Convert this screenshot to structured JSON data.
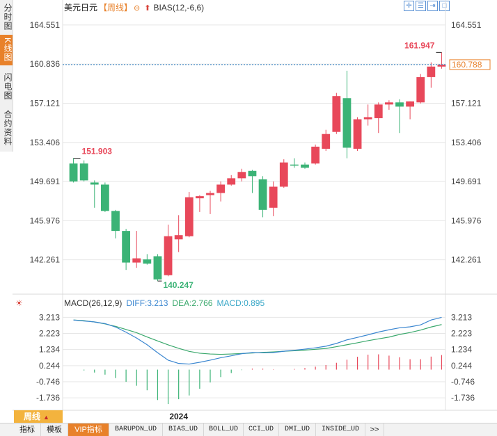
{
  "side_tabs": [
    "分时图",
    "K线图",
    "闪电图",
    "合约资料"
  ],
  "header": {
    "symbol": "美元日元",
    "period": "【周线】",
    "indicator": "BIAS(12,-6,6)"
  },
  "chart_data": {
    "type": "candlestick",
    "y_ticks": [
      "164.551",
      "160.836",
      "157.121",
      "153.406",
      "149.691",
      "145.976",
      "142.261"
    ],
    "ylim": [
      139.2,
      165.6
    ],
    "current_price": "160.788",
    "x_tick_label": "2024",
    "annotations": [
      {
        "text": "151.903",
        "kind": "high"
      },
      {
        "text": "140.247",
        "kind": "low"
      },
      {
        "text": "161.947",
        "kind": "high"
      }
    ],
    "candles": [
      {
        "o": 151.4,
        "h": 151.903,
        "l": 149.6,
        "c": 149.7
      },
      {
        "o": 151.4,
        "h": 151.7,
        "l": 149.7,
        "c": 149.8
      },
      {
        "o": 149.6,
        "h": 149.8,
        "l": 147.2,
        "c": 149.4
      },
      {
        "o": 149.4,
        "h": 149.6,
        "l": 146.8,
        "c": 146.9
      },
      {
        "o": 146.9,
        "h": 147.0,
        "l": 144.3,
        "c": 145.0
      },
      {
        "o": 145.0,
        "h": 145.2,
        "l": 141.3,
        "c": 142.0
      },
      {
        "o": 142.0,
        "h": 145.0,
        "l": 141.5,
        "c": 142.4
      },
      {
        "o": 142.3,
        "h": 142.8,
        "l": 141.8,
        "c": 141.9
      },
      {
        "o": 142.6,
        "h": 142.8,
        "l": 140.247,
        "c": 140.4
      },
      {
        "o": 140.8,
        "h": 145.6,
        "l": 140.7,
        "c": 144.5
      },
      {
        "o": 144.2,
        "h": 146.5,
        "l": 143.0,
        "c": 144.6
      },
      {
        "o": 144.5,
        "h": 148.7,
        "l": 144.4,
        "c": 148.2
      },
      {
        "o": 148.1,
        "h": 148.4,
        "l": 146.8,
        "c": 148.3
      },
      {
        "o": 148.4,
        "h": 148.8,
        "l": 146.6,
        "c": 148.6
      },
      {
        "o": 148.6,
        "h": 149.7,
        "l": 147.8,
        "c": 149.4
      },
      {
        "o": 149.4,
        "h": 150.3,
        "l": 149.3,
        "c": 150.0
      },
      {
        "o": 150.0,
        "h": 150.9,
        "l": 149.7,
        "c": 150.6
      },
      {
        "o": 150.7,
        "h": 150.8,
        "l": 148.6,
        "c": 150.2
      },
      {
        "o": 149.9,
        "h": 150.2,
        "l": 146.3,
        "c": 147.0
      },
      {
        "o": 147.2,
        "h": 149.7,
        "l": 146.4,
        "c": 149.2
      },
      {
        "o": 149.2,
        "h": 151.8,
        "l": 149.1,
        "c": 151.5
      },
      {
        "o": 151.3,
        "h": 151.9,
        "l": 151.0,
        "c": 151.2
      },
      {
        "o": 151.3,
        "h": 151.5,
        "l": 150.9,
        "c": 151.0
      },
      {
        "o": 151.4,
        "h": 153.2,
        "l": 151.3,
        "c": 153.0
      },
      {
        "o": 152.8,
        "h": 154.6,
        "l": 152.6,
        "c": 154.2
      },
      {
        "o": 154.4,
        "h": 158.1,
        "l": 154.2,
        "c": 157.8
      },
      {
        "o": 157.6,
        "h": 160.2,
        "l": 151.9,
        "c": 152.9
      },
      {
        "o": 152.8,
        "h": 155.8,
        "l": 152.6,
        "c": 155.6
      },
      {
        "o": 155.6,
        "h": 157.0,
        "l": 155.0,
        "c": 155.8
      },
      {
        "o": 155.7,
        "h": 157.2,
        "l": 154.3,
        "c": 157.0
      },
      {
        "o": 157.0,
        "h": 157.4,
        "l": 156.5,
        "c": 157.2
      },
      {
        "o": 157.2,
        "h": 157.5,
        "l": 154.3,
        "c": 156.8
      },
      {
        "o": 156.8,
        "h": 157.3,
        "l": 155.6,
        "c": 157.3
      },
      {
        "o": 157.2,
        "h": 159.9,
        "l": 157.1,
        "c": 159.6
      },
      {
        "o": 159.6,
        "h": 161.0,
        "l": 158.6,
        "c": 160.6
      },
      {
        "o": 160.6,
        "h": 161.947,
        "l": 160.4,
        "c": 160.788
      }
    ]
  },
  "macd": {
    "title": "MACD(26,12,9)",
    "diff": "DIFF:3.213",
    "dea": "DEA:2.766",
    "macd": "MACD:0.895",
    "y_ticks": [
      "3.213",
      "2.223",
      "1.234",
      "0.244",
      "-0.746",
      "-1.736"
    ],
    "ylim": [
      -2.5,
      3.7
    ],
    "diff_values": [
      3.05,
      2.99,
      2.93,
      2.83,
      2.62,
      2.3,
      1.94,
      1.53,
      1.04,
      0.58,
      0.38,
      0.34,
      0.45,
      0.58,
      0.73,
      0.85,
      0.98,
      1.05,
      1.03,
      1.05,
      1.13,
      1.19,
      1.26,
      1.34,
      1.44,
      1.61,
      1.83,
      1.98,
      2.14,
      2.31,
      2.45,
      2.57,
      2.63,
      2.75,
      3.05,
      3.21
    ],
    "dea_values": [
      3.05,
      3.01,
      2.93,
      2.81,
      2.66,
      2.47,
      2.27,
      2.01,
      1.76,
      1.52,
      1.31,
      1.12,
      1.01,
      0.96,
      0.94,
      0.96,
      0.99,
      1.02,
      1.06,
      1.09,
      1.13,
      1.16,
      1.2,
      1.25,
      1.3,
      1.41,
      1.53,
      1.65,
      1.78,
      1.89,
      2.0,
      2.16,
      2.28,
      2.43,
      2.62,
      2.77
    ],
    "hist_values": [
      0.0,
      -0.05,
      -0.18,
      -0.31,
      -0.52,
      -0.75,
      -0.99,
      -1.27,
      -1.87,
      -2.12,
      -1.82,
      -1.59,
      -1.18,
      -0.79,
      -0.46,
      -0.21,
      -0.03,
      0.06,
      0.06,
      0.02,
      0.0,
      0.04,
      0.1,
      0.18,
      0.28,
      0.42,
      0.61,
      0.79,
      0.92,
      0.94,
      0.86,
      0.76,
      0.64,
      0.64,
      0.8,
      0.895
    ]
  },
  "bottom_tabs": [
    "指标",
    "模板",
    "VIP指标",
    "BARUPDN_UD",
    "BIAS_UD",
    "BOLL_UD",
    "CCI_UD",
    "DMI_UD",
    "INSIDE_UD",
    ">>"
  ],
  "period_selector": "周线",
  "colors": {
    "up": "#e8485a",
    "down": "#3bb376",
    "diff": "#3a86d0",
    "dea": "#3aa86c",
    "price_line": "#2f7fc4",
    "grid": "#e6e6e6"
  },
  "icons": [
    "window-grid-icon",
    "list-icon",
    "exit-icon",
    "maximize-icon"
  ]
}
